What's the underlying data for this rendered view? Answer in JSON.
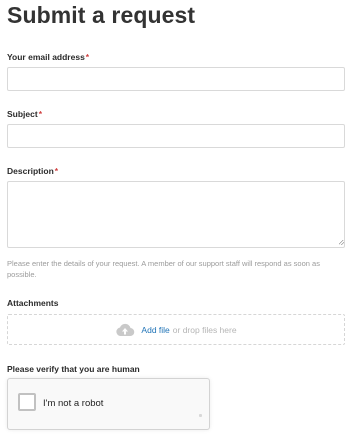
{
  "page": {
    "title": "Submit a request"
  },
  "form": {
    "email": {
      "label": "Your email address",
      "required_mark": "*",
      "value": "",
      "placeholder": ""
    },
    "subject": {
      "label": "Subject",
      "required_mark": "*",
      "value": "",
      "placeholder": ""
    },
    "description": {
      "label": "Description",
      "required_mark": "*",
      "value": "",
      "placeholder": "",
      "hint": "Please enter the details of your request. A member of our support staff will respond as soon as possible."
    },
    "attachments": {
      "label": "Attachments",
      "add_file": "Add file",
      "drop_text": "or drop files here",
      "icon": "cloud-upload-icon"
    },
    "verify": {
      "label": "Please verify that you are human",
      "checkbox_text": "I'm not a robot",
      "checked": false
    }
  },
  "colors": {
    "required": "#d04040",
    "link": "#1f73b7",
    "hint": "#9b9b9b",
    "border": "#d9d9d9"
  }
}
